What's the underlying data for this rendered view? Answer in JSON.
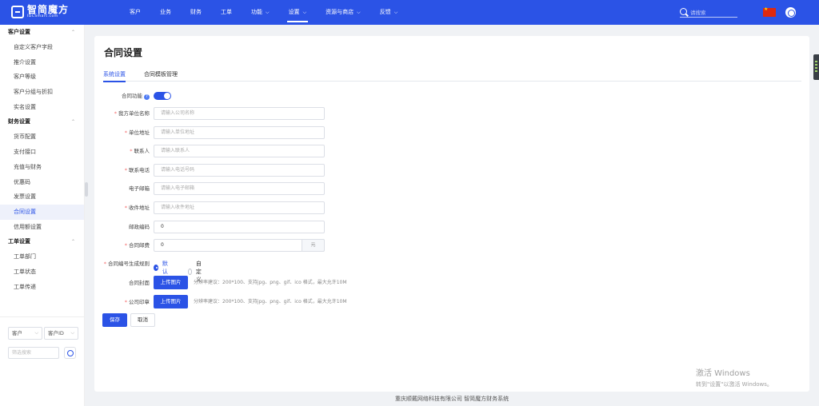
{
  "brand": {
    "name": "智简魔方",
    "sub": "IDCSmart.com"
  },
  "nav": [
    {
      "label": "客户",
      "dropdown": false
    },
    {
      "label": "业务",
      "dropdown": false
    },
    {
      "label": "财务",
      "dropdown": false
    },
    {
      "label": "工单",
      "dropdown": false
    },
    {
      "label": "功能",
      "dropdown": true
    },
    {
      "label": "设置",
      "dropdown": true
    },
    {
      "label": "资源与商店",
      "dropdown": true
    },
    {
      "label": "反馈",
      "dropdown": true
    }
  ],
  "header": {
    "search_placeholder": "请搜索"
  },
  "sidebar": {
    "groups": [
      {
        "label": "客户设置",
        "items": [
          "自定义客户字段",
          "推介设置",
          "客户等级",
          "客户分组与折扣",
          "实名设置"
        ]
      },
      {
        "label": "财务设置",
        "items": [
          "货币配置",
          "支付接口",
          "充值与财务",
          "优惠码",
          "发票设置",
          "合同设置",
          "信用额设置"
        ]
      },
      {
        "label": "工单设置",
        "items": [
          "工单部门",
          "工单状态",
          "工单传递"
        ]
      }
    ],
    "active_item": "合同设置",
    "filter": {
      "select1": "客户",
      "select2": "客户ID",
      "query_placeholder": "筛选搜索"
    }
  },
  "page": {
    "title": "合同设置",
    "tabs": [
      "系统设置",
      "合同模板管理"
    ],
    "active_tab": "系统设置",
    "form": {
      "contract_feature": {
        "label": "合同功能",
        "enabled": true
      },
      "company_name": {
        "label": "我方单位名称",
        "required": true,
        "placeholder": "请输入公司名称"
      },
      "address": {
        "label": "单位地址",
        "required": true,
        "placeholder": "请输入单位地址"
      },
      "contact": {
        "label": "联系人",
        "required": true,
        "placeholder": "请输入联系人"
      },
      "phone": {
        "label": "联系电话",
        "required": true,
        "placeholder": "请输入电话号码"
      },
      "email": {
        "label": "电子邮箱",
        "required": false,
        "placeholder": "请输入电子邮箱"
      },
      "receive_address": {
        "label": "收件地址",
        "required": true,
        "placeholder": "请输入收件地址"
      },
      "postcode": {
        "label": "邮政编码",
        "required": false,
        "value": "0"
      },
      "postage": {
        "label": "合同邮费",
        "required": true,
        "value": "0",
        "suffix": "元"
      },
      "number_rule": {
        "label": "合同编号生成规则",
        "required": true,
        "options": [
          "默认",
          "自定义"
        ],
        "selected": "默认"
      },
      "cover": {
        "label": "合同封面",
        "required": false,
        "button": "上传图片",
        "hint": "分辨率建议：200*100、支持jpg、png、gif、ico 格式，最大允许10M"
      },
      "seal": {
        "label": "公司印章",
        "required": true,
        "button": "上传图片",
        "hint": "分辨率建议：200*100、支持jpg、png、gif、ico 格式，最大允许10M"
      }
    },
    "save_label": "保存",
    "cancel_label": "取消"
  },
  "watermark": {
    "line1": "激活 Windows",
    "line2": "转到\"设置\"以激活 Windows。"
  },
  "footer": "重庆顺戴网络科技有限公司 智简魔方财务系统",
  "colors": {
    "primary": "#2b53e6",
    "required": "#f56c6c",
    "background": "#f0f2f5"
  }
}
